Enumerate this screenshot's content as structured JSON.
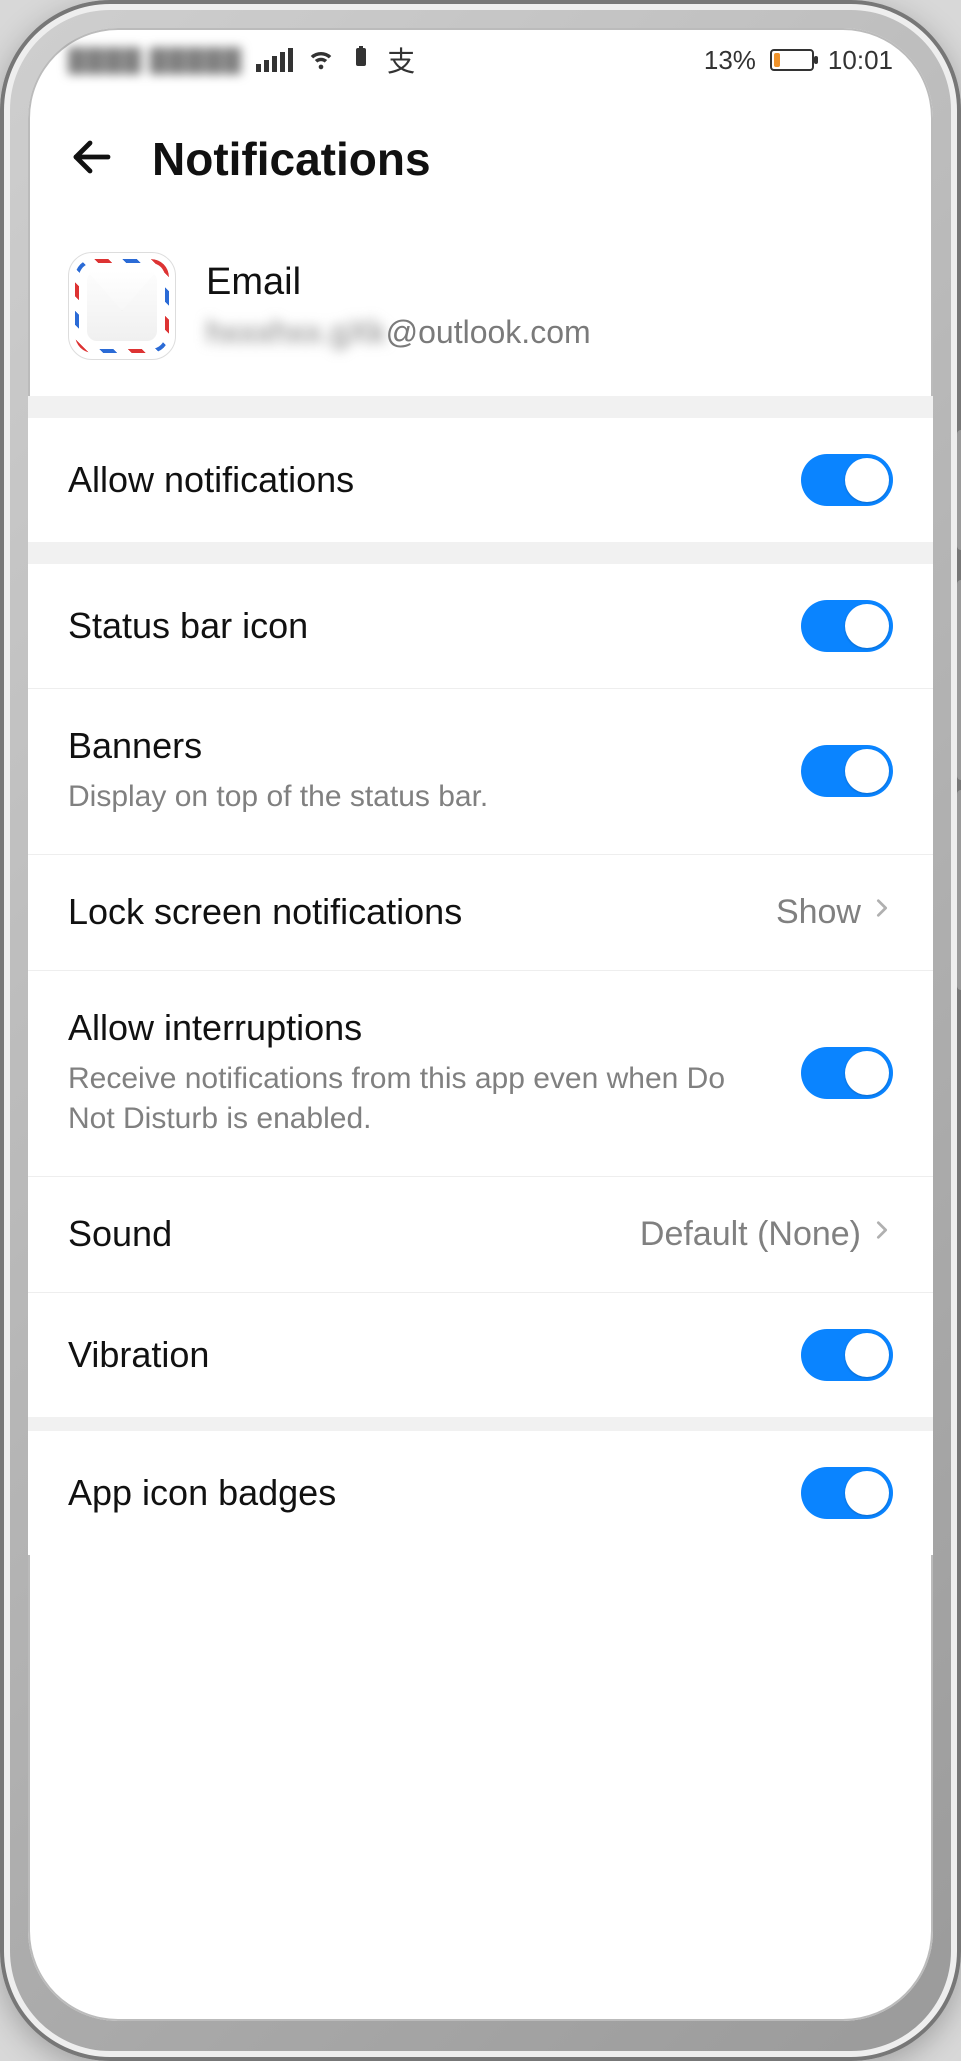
{
  "statusbar": {
    "carrier_obscured": "▓▓▓▓ ▓▓▓▓▓",
    "battery_pct": "13%",
    "time": "10:01"
  },
  "header": {
    "title": "Notifications"
  },
  "app": {
    "name": "Email",
    "account_suffix": "@outlook.com"
  },
  "rows": {
    "allow_notifications": {
      "label": "Allow notifications",
      "on": true
    },
    "status_bar_icon": {
      "label": "Status bar icon",
      "on": true
    },
    "banners": {
      "label": "Banners",
      "sub": "Display on top of the status bar.",
      "on": true
    },
    "lock_screen": {
      "label": "Lock screen notifications",
      "value": "Show"
    },
    "allow_interruptions": {
      "label": "Allow interruptions",
      "sub": "Receive notifications from this app even when Do Not Disturb is enabled.",
      "on": true
    },
    "sound": {
      "label": "Sound",
      "value": "Default (None)"
    },
    "vibration": {
      "label": "Vibration",
      "on": true
    },
    "app_icon_badges": {
      "label": "App icon badges",
      "on": true
    }
  }
}
